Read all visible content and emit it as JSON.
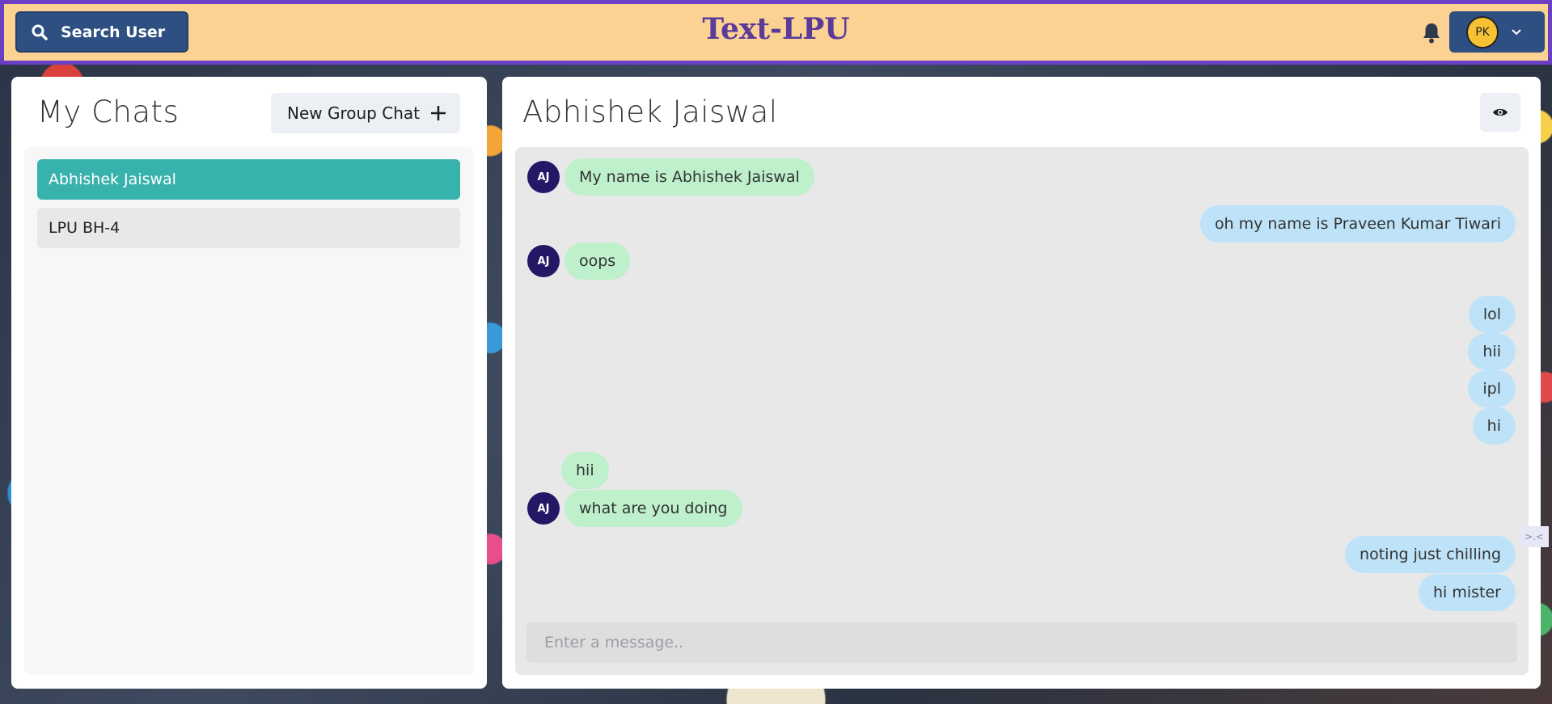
{
  "header": {
    "search_label": "Search User",
    "app_title": "Text-LPU",
    "profile_initials": "PK",
    "bell_icon": "bell-icon",
    "search_icon": "search-icon",
    "chevron_icon": "chevron-down-icon"
  },
  "sidebar": {
    "title": "My Chats",
    "new_group_label": "New Group Chat",
    "new_group_icon": "plus-icon",
    "chats": [
      {
        "name": "Abhishek Jaiswal",
        "active": true
      },
      {
        "name": "LPU BH-4",
        "active": false
      }
    ]
  },
  "chat": {
    "title": "Abhishek Jaiswal",
    "view_icon": "eye-icon",
    "messages": [
      {
        "text": "My name is Abhishek Jaiswal",
        "from": "them",
        "avatar": "AJ"
      },
      {
        "text": "oh my name is Praveen Kumar Tiwari",
        "from": "me"
      },
      {
        "text": "oops",
        "from": "them",
        "avatar": "AJ"
      },
      {
        "text": "lol",
        "from": "me"
      },
      {
        "text": "hii",
        "from": "me"
      },
      {
        "text": "ipl",
        "from": "me"
      },
      {
        "text": "hi",
        "from": "me"
      },
      {
        "text": "hii",
        "from": "them"
      },
      {
        "text": "what are you doing",
        "from": "them",
        "avatar": "AJ"
      },
      {
        "text": "noting just chilling",
        "from": "me"
      },
      {
        "text": "hi mister",
        "from": "me"
      }
    ],
    "input_placeholder": "Enter a message.."
  },
  "colors": {
    "header_bg": "#fbd291",
    "header_border": "#6a3fc4",
    "brand_button": "#2d4f82",
    "active_chat": "#38b2ac",
    "incoming_bubble": "#bdf0cb",
    "outgoing_bubble": "#bee3f8",
    "avatar_bg": "#231866"
  }
}
